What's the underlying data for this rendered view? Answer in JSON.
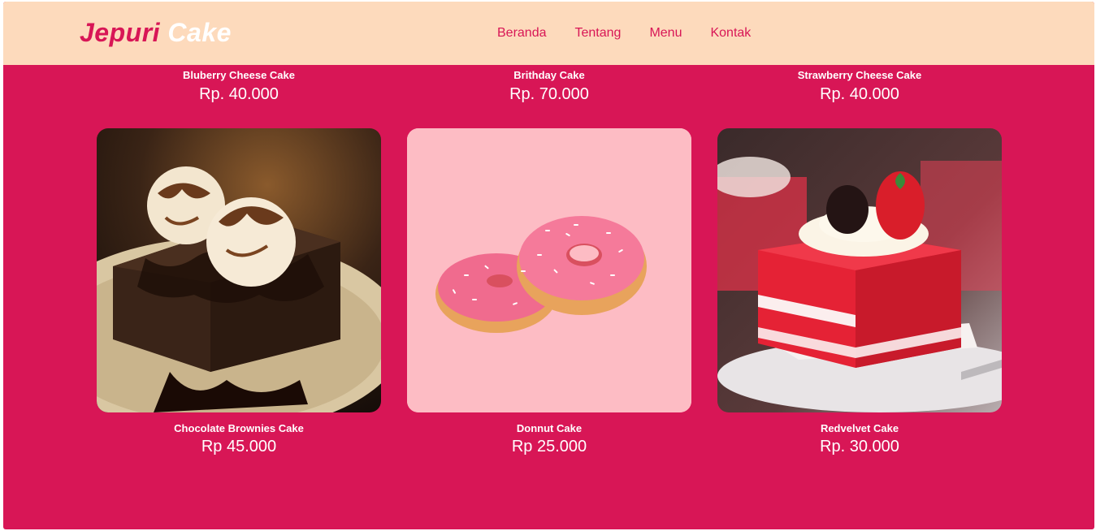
{
  "brand": {
    "part1": "Jepuri",
    "part2": "Cake"
  },
  "nav": {
    "items": [
      {
        "label": "Beranda"
      },
      {
        "label": "Tentang"
      },
      {
        "label": "Menu"
      },
      {
        "label": "Kontak"
      }
    ]
  },
  "products_top": [
    {
      "name": "Bluberry Cheese Cake",
      "price": "Rp. 40.000"
    },
    {
      "name": "Brithday Cake",
      "price": "Rp. 70.000"
    },
    {
      "name": "Strawberry Cheese Cake",
      "price": "Rp. 40.000"
    }
  ],
  "products": [
    {
      "name": "Chocolate Brownies Cake",
      "price": "Rp 45.000",
      "image_icon": "brownie-icon"
    },
    {
      "name": "Donnut Cake",
      "price": "Rp 25.000",
      "image_icon": "donut-icon"
    },
    {
      "name": "Redvelvet Cake",
      "price": "Rp. 30.000",
      "image_icon": "red-velvet-cake-icon"
    }
  ],
  "colors": {
    "primary": "#d81656",
    "navbar": "#fddabc",
    "donut_bg": "#fdbcc4"
  }
}
